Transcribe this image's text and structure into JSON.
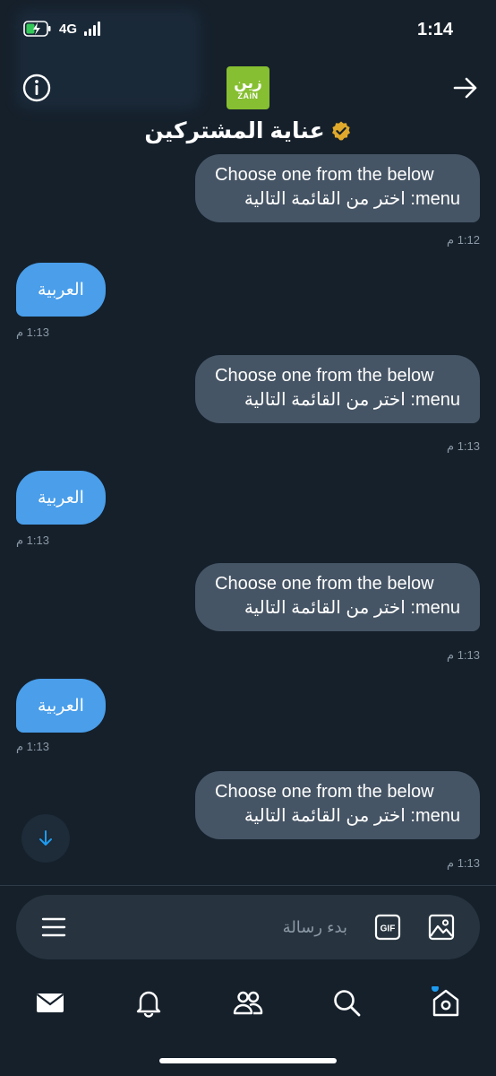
{
  "status_bar": {
    "network": "4G",
    "time": "1:14"
  },
  "header": {
    "avatar_text_ar": "زين",
    "avatar_text_en": "ZAiN",
    "title": "عناية المشتركين",
    "verified_color": "#e0a92b"
  },
  "messages": [
    {
      "type": "out",
      "line1": "Choose one from the below",
      "line2": "menu: اختر من القائمة التالية",
      "time": "1:12 م"
    },
    {
      "type": "in",
      "text": "العربية",
      "time": "1:13 م"
    },
    {
      "type": "out",
      "line1": "Choose one from the below",
      "line2": "menu: اختر من القائمة التالية",
      "time": "1:13 م"
    },
    {
      "type": "in",
      "text": "العربية",
      "time": "1:13 م"
    },
    {
      "type": "out",
      "line1": "Choose one from the below",
      "line2": "menu: اختر من القائمة التالية",
      "time": "1:13 م"
    },
    {
      "type": "in",
      "text": "العربية",
      "time": "1:13 م"
    },
    {
      "type": "out",
      "line1": "Choose one from the below",
      "line2": "menu: اختر من القائمة التالية",
      "time": "1:13 م"
    }
  ],
  "composer": {
    "placeholder": "بدء رسالة",
    "gif_label": "GIF"
  },
  "colors": {
    "background": "#15202b",
    "bubble_out": "#465565",
    "bubble_in": "#4a9eea",
    "accent": "#1d9bf0",
    "brand": "#86bf31"
  },
  "icons": {
    "info": "info-icon",
    "back": "arrow-right-icon",
    "scroll": "arrow-down-icon",
    "menu": "menu-icon",
    "gif": "gif-icon",
    "image": "image-icon",
    "nav": [
      "mail-icon",
      "bell-icon",
      "people-icon",
      "search-icon",
      "home-icon"
    ]
  }
}
